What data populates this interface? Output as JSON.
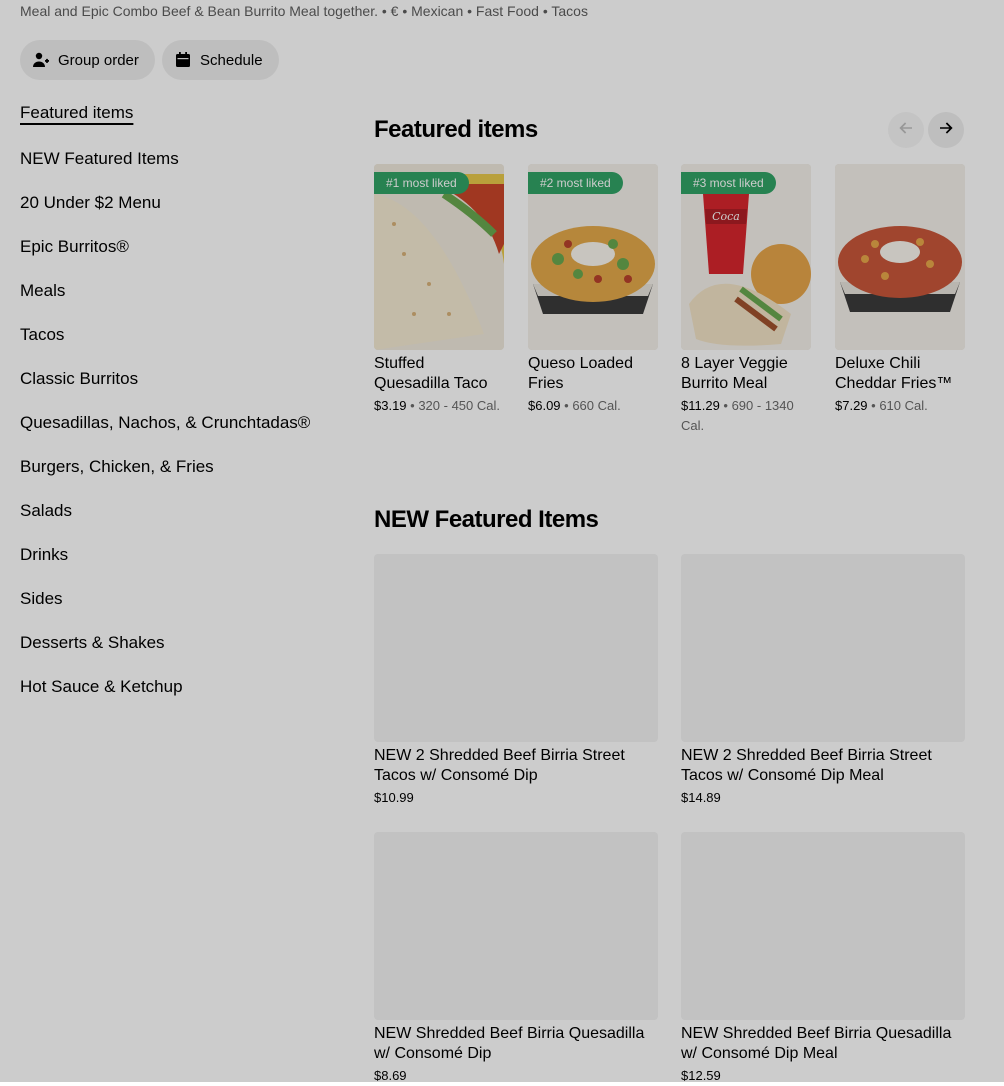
{
  "store": {
    "subtitle": "Meal and Epic Combo Beef & Bean Burrito Meal together. • € • Mexican • Fast Food • Tacos"
  },
  "actions": {
    "group_order": "Group order",
    "schedule": "Schedule"
  },
  "sidebar": {
    "items": [
      {
        "label": "Featured items"
      },
      {
        "label": "NEW Featured Items"
      },
      {
        "label": "20 Under $2 Menu"
      },
      {
        "label": "Epic Burritos®"
      },
      {
        "label": "Meals"
      },
      {
        "label": "Tacos"
      },
      {
        "label": "Classic Burritos"
      },
      {
        "label": "Quesadillas, Nachos, & Crunchtadas®"
      },
      {
        "label": "Burgers, Chicken, & Fries"
      },
      {
        "label": "Salads"
      },
      {
        "label": "Drinks"
      },
      {
        "label": "Sides"
      },
      {
        "label": "Desserts & Shakes"
      },
      {
        "label": "Hot Sauce & Ketchup"
      }
    ]
  },
  "featured": {
    "title": "Featured items",
    "items": [
      {
        "badge": "#1 most liked",
        "name": "Stuffed Quesadilla Taco",
        "price": "$3.19",
        "cal": " • 320 - 450 Cal."
      },
      {
        "badge": "#2 most liked",
        "name": "Queso Loaded Fries",
        "price": "$6.09",
        "cal": " • 660 Cal."
      },
      {
        "badge": "#3 most liked",
        "name": "8 Layer Veggie Burrito Meal",
        "price": "$11.29",
        "cal": " • 690 - 1340 Cal."
      },
      {
        "name": "Deluxe Chili Cheddar Fries™",
        "price": "$7.29",
        "cal": " • 610 Cal."
      }
    ]
  },
  "new_featured": {
    "title": "NEW Featured Items",
    "items": [
      {
        "name": "NEW 2 Shredded Beef Birria Street Tacos w/ Consomé Dip",
        "price": "$10.99"
      },
      {
        "name": "NEW 2 Shredded Beef Birria Street Tacos w/ Consomé Dip Meal",
        "price": "$14.89"
      },
      {
        "name": "NEW Shredded Beef Birria Quesadilla w/ Consomé Dip",
        "price": "$8.69"
      },
      {
        "name": "NEW Shredded Beef Birria Quesadilla w/ Consomé Dip Meal",
        "price": "$12.59"
      }
    ]
  },
  "colors": {
    "badge": "#31a366",
    "pill": "#eeeeee",
    "placeholder": "#f3f3f3"
  },
  "icons": {
    "group_order": "add-person-icon",
    "schedule": "calendar-icon",
    "prev": "arrow-left-icon",
    "next": "arrow-right-icon"
  }
}
